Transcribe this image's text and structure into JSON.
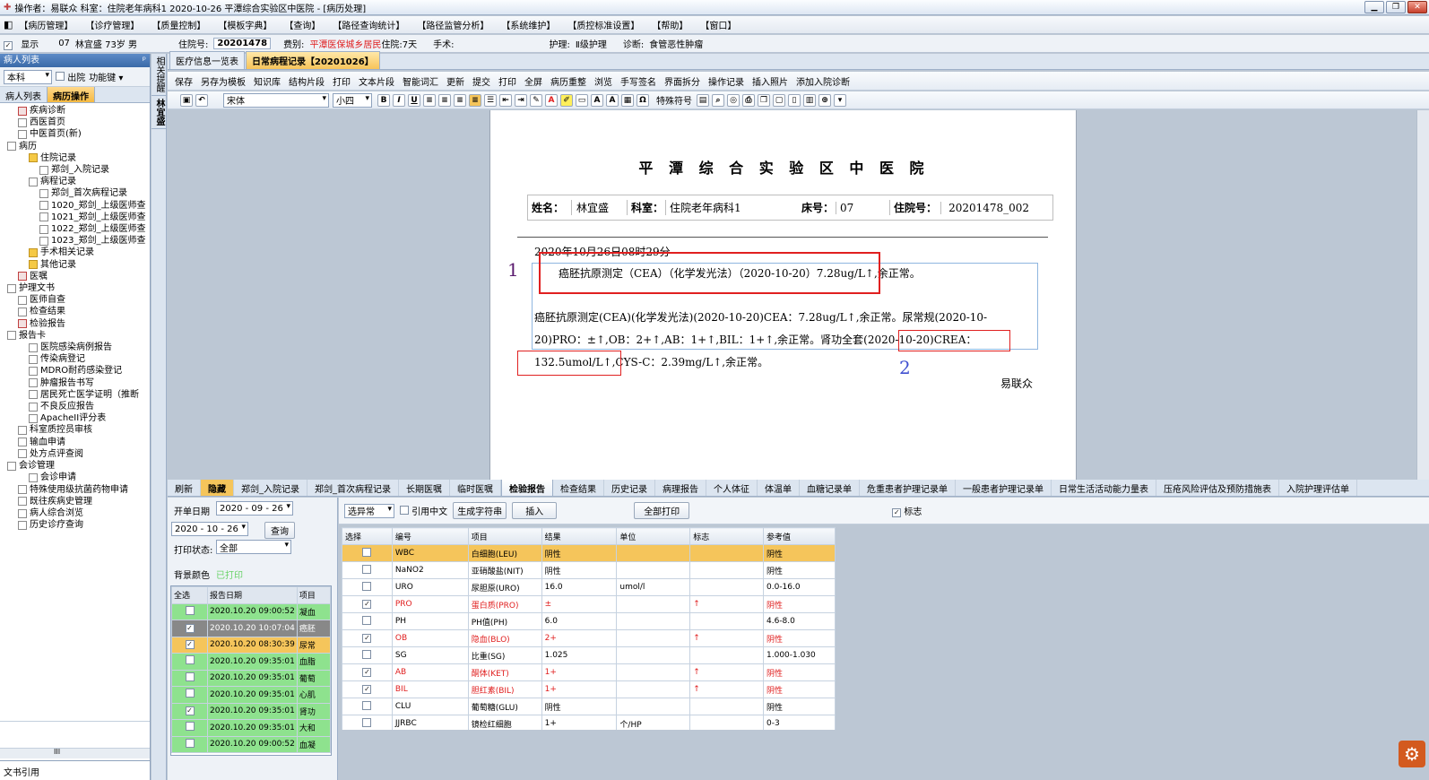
{
  "window": {
    "title": "操作者：易联众  科室：住院老年病科1  2020-10-26  平潭综合实验区中医院 - [病历处理]"
  },
  "menu": [
    "【病历管理】",
    "【诊疗管理】",
    "【质量控制】",
    "【模板字典】",
    "【查询】",
    "【路径查询统计】",
    "【路径监管分析】",
    "【系统维护】",
    "【质控标准设置】",
    "【帮助】",
    "【窗口】"
  ],
  "patient_bar": {
    "show_label": "显示",
    "bed": "07",
    "name_info": "林宜盛 73岁 男",
    "admit_label": "住院号:",
    "admit_no": "20201478",
    "type_label": "费别:",
    "type_value": "平潭医保城乡居民",
    "stay": "住院:7天",
    "surgery_label": "手术:",
    "nursing_label": "护理:",
    "nursing_value": "Ⅱ级护理",
    "diagnosis_label": "诊断:",
    "diagnosis_value": "食管恶性肿瘤"
  },
  "left_panel": {
    "title": "病人列表",
    "pin": "ᵖ",
    "scope": "本科",
    "discharged": "出院",
    "function_key": "功能键",
    "tabs": [
      "病人列表",
      "病历操作"
    ],
    "footer": "文书引用",
    "scroll_mark": "III"
  },
  "tree": [
    {
      "label": "疾病诊断",
      "depth": 1,
      "icon": "r"
    },
    {
      "label": "西医首页",
      "depth": 1,
      "icon": "n"
    },
    {
      "label": "中医首页(新)",
      "depth": 1,
      "icon": "n"
    },
    {
      "label": "病历",
      "depth": 0,
      "icon": "n"
    },
    {
      "label": "住院记录",
      "depth": 2,
      "icon": "f"
    },
    {
      "label": "郑剑_入院记录",
      "depth": 3,
      "icon": "n"
    },
    {
      "label": "病程记录",
      "depth": 2,
      "icon": "n"
    },
    {
      "label": "郑剑_首次病程记录",
      "depth": 3,
      "icon": "n"
    },
    {
      "label": "1020_郑剑_上级医师查",
      "depth": 3,
      "icon": "n"
    },
    {
      "label": "1021_郑剑_上级医师查",
      "depth": 3,
      "icon": "n"
    },
    {
      "label": "1022_郑剑_上级医师查",
      "depth": 3,
      "icon": "n"
    },
    {
      "label": "1023_郑剑_上级医师查",
      "depth": 3,
      "icon": "n"
    },
    {
      "label": "手术相关记录",
      "depth": 2,
      "icon": "f"
    },
    {
      "label": "其他记录",
      "depth": 2,
      "icon": "f"
    },
    {
      "label": "医嘱",
      "depth": 1,
      "icon": "r"
    },
    {
      "label": "护理文书",
      "depth": 0,
      "icon": "n"
    },
    {
      "label": "医师自查",
      "depth": 1,
      "icon": "n"
    },
    {
      "label": "检查结果",
      "depth": 1,
      "icon": "n"
    },
    {
      "label": "检验报告",
      "depth": 1,
      "icon": "r"
    },
    {
      "label": "报告卡",
      "depth": 0,
      "icon": "n"
    },
    {
      "label": "医院感染病例报告",
      "depth": 2,
      "icon": "n"
    },
    {
      "label": "传染病登记",
      "depth": 2,
      "icon": "n"
    },
    {
      "label": "MDRO耐药感染登记",
      "depth": 2,
      "icon": "n"
    },
    {
      "label": "肿瘤报告书写",
      "depth": 2,
      "icon": "n"
    },
    {
      "label": "居民死亡医学证明（推断",
      "depth": 2,
      "icon": "n"
    },
    {
      "label": "不良反应报告",
      "depth": 2,
      "icon": "n"
    },
    {
      "label": "ApacheII评分表",
      "depth": 2,
      "icon": "n"
    },
    {
      "label": "科室质控员审核",
      "depth": 1,
      "icon": "n"
    },
    {
      "label": "输血申请",
      "depth": 1,
      "icon": "n"
    },
    {
      "label": "处方点评查阅",
      "depth": 1,
      "icon": "n"
    },
    {
      "label": "会诊管理",
      "depth": 0,
      "icon": "n"
    },
    {
      "label": "会诊申请",
      "depth": 2,
      "icon": "n"
    },
    {
      "label": "特殊使用级抗菌药物申请",
      "depth": 1,
      "icon": "n"
    },
    {
      "label": "既往疾病史管理",
      "depth": 1,
      "icon": "n"
    },
    {
      "label": "病人综合浏览",
      "depth": 1,
      "icon": "n"
    },
    {
      "label": "历史诊疗查询",
      "depth": 1,
      "icon": "n"
    }
  ],
  "vertical_tabs": [
    "相关提醒",
    "林宜盛"
  ],
  "doc_tabs": [
    "医疗信息一览表",
    "日常病程记录【20201026】"
  ],
  "toolbar1": [
    "保存",
    "另存为模板",
    "知识库",
    "结构片段",
    "打印",
    "文本片段",
    "智能词汇",
    "更新",
    "提交",
    "打印",
    "全屏",
    "病历重整",
    "浏览",
    "手写签名",
    "界面拆分",
    "操作记录",
    "插入照片",
    "添加入院诊断"
  ],
  "toolbar2": {
    "font": "宋体",
    "size": "小四",
    "special": "特殊符号"
  },
  "doc": {
    "hospital": "平 潭 综 合 实 验 区 中 医 院",
    "header": [
      {
        "label": "姓名：",
        "value": "林宜盛"
      },
      {
        "label": "科室：",
        "value": "住院老年病科1"
      },
      {
        "label": "床号：",
        "value": "07"
      },
      {
        "label": "住院号：",
        "value": "20201478_002"
      }
    ],
    "datetime": "2020年10月26日08时29分",
    "line1": "癌胚抗原测定（CEA）（化学发光法）（2020-10-20）7.28ug/L↑,余正常。",
    "para": "癌胚抗原测定(CEA)(化学发光法)(2020-10-20)CEA：7.28ug/L↑,余正常。尿常规(2020-10-20)PRO：±↑,OB：2+↑,AB：1+↑,BIL：1+↑,余正常。肾功全套(2020-10-20)CREA：132.5umol/L↑,CYS-C：2.39mg/L↑,余正常。",
    "signature": "易联众",
    "annot1": "1",
    "annot2": "2"
  },
  "bottom_tabs": [
    "刷新",
    "隐藏",
    "郑剑_入院记录",
    "郑剑_首次病程记录",
    "长期医嘱",
    "临时医嘱",
    "检验报告",
    "检查结果",
    "历史记录",
    "病理报告",
    "个人体征",
    "体温单",
    "血糖记录单",
    "危重患者护理记录单",
    "一般患者护理记录单",
    "日常生活活动能力量表",
    "压疮风险评估及预防措施表",
    "入院护理评估单"
  ],
  "filter": {
    "start_label": "开单日期",
    "start_date": "2020 - 09 - 26",
    "end_date": "2020 - 10 - 26",
    "query": "查询",
    "print_label": "打印状态:",
    "print_value": "全部",
    "bg_label": "背景颜色",
    "bg_value": "已打印",
    "col_all": "全选",
    "col_date": "报告日期",
    "col_item": "项目"
  },
  "reports": [
    {
      "date": "2020.10.20 09:00:52",
      "item": "凝血",
      "checked": false,
      "style": "g"
    },
    {
      "date": "2020.10.20 10:07:04",
      "item": "癌胚",
      "checked": true,
      "style": "dk"
    },
    {
      "date": "2020.10.20 08:30:39",
      "item": "尿常",
      "checked": true,
      "style": "or"
    },
    {
      "date": "2020.10.20 09:35:01",
      "item": "血脂",
      "checked": false,
      "style": "g"
    },
    {
      "date": "2020.10.20 09:35:01",
      "item": "葡萄",
      "checked": false,
      "style": "g"
    },
    {
      "date": "2020.10.20 09:35:01",
      "item": "心肌",
      "checked": false,
      "style": "g"
    },
    {
      "date": "2020.10.20 09:35:01",
      "item": "肾功",
      "checked": true,
      "style": "g"
    },
    {
      "date": "2020.10.20 09:35:01",
      "item": "大和",
      "checked": false,
      "style": "g"
    },
    {
      "date": "2020.10.20 09:00:52",
      "item": "血凝",
      "checked": false,
      "style": "g"
    }
  ],
  "lab_controls": {
    "filter": "选异常",
    "chinese": "引用中文",
    "generate": "生成字符串",
    "insert": "插入",
    "print_all": "全部打印",
    "flag": "标志"
  },
  "lab_columns": [
    "选择",
    "编号",
    "项目",
    "结果",
    "单位",
    "标志",
    "参考值"
  ],
  "lab_rows": [
    {
      "code": "WBC",
      "item": "白细胞(LEU)",
      "result": "阴性",
      "unit": "",
      "flag": "",
      "ref": "阴性",
      "checked": false,
      "red": false,
      "sel": true
    },
    {
      "code": "NaNO2",
      "item": "亚硝酸盐(NIT)",
      "result": "阴性",
      "unit": "",
      "flag": "",
      "ref": "阴性",
      "checked": false,
      "red": false,
      "sel": false
    },
    {
      "code": "URO",
      "item": "尿胆原(URO)",
      "result": "16.0",
      "unit": "umol/l",
      "flag": "",
      "ref": "0.0-16.0",
      "checked": false,
      "red": false,
      "sel": false
    },
    {
      "code": "PRO",
      "item": "蛋白质(PRO)",
      "result": "±",
      "unit": "",
      "flag": "↑",
      "ref": "阴性",
      "checked": true,
      "red": true,
      "sel": false
    },
    {
      "code": "PH",
      "item": "PH值(PH)",
      "result": "6.0",
      "unit": "",
      "flag": "",
      "ref": "4.6-8.0",
      "checked": false,
      "red": false,
      "sel": false
    },
    {
      "code": "OB",
      "item": "隐血(BLO)",
      "result": "2+",
      "unit": "",
      "flag": "↑",
      "ref": "阴性",
      "checked": true,
      "red": true,
      "sel": false
    },
    {
      "code": "SG",
      "item": "比重(SG)",
      "result": "1.025",
      "unit": "",
      "flag": "",
      "ref": "1.000-1.030",
      "checked": false,
      "red": false,
      "sel": false
    },
    {
      "code": "AB",
      "item": "酮体(KET)",
      "result": "1+",
      "unit": "",
      "flag": "↑",
      "ref": "阴性",
      "checked": true,
      "red": true,
      "sel": false
    },
    {
      "code": "BIL",
      "item": "胆红素(BIL)",
      "result": "1+",
      "unit": "",
      "flag": "↑",
      "ref": "阴性",
      "checked": true,
      "red": true,
      "sel": false
    },
    {
      "code": "CLU",
      "item": "葡萄糖(GLU)",
      "result": "阴性",
      "unit": "",
      "flag": "",
      "ref": "阴性",
      "checked": false,
      "red": false,
      "sel": false
    },
    {
      "code": "JJRBC",
      "item": "镜检红细胞",
      "result": "1+",
      "unit": "个/HP",
      "flag": "",
      "ref": "0-3",
      "checked": false,
      "red": false,
      "sel": false
    }
  ],
  "colors": {
    "accent": "#f5c55b",
    "highlight_red": "#e02020",
    "green_row": "#8ee28e"
  }
}
